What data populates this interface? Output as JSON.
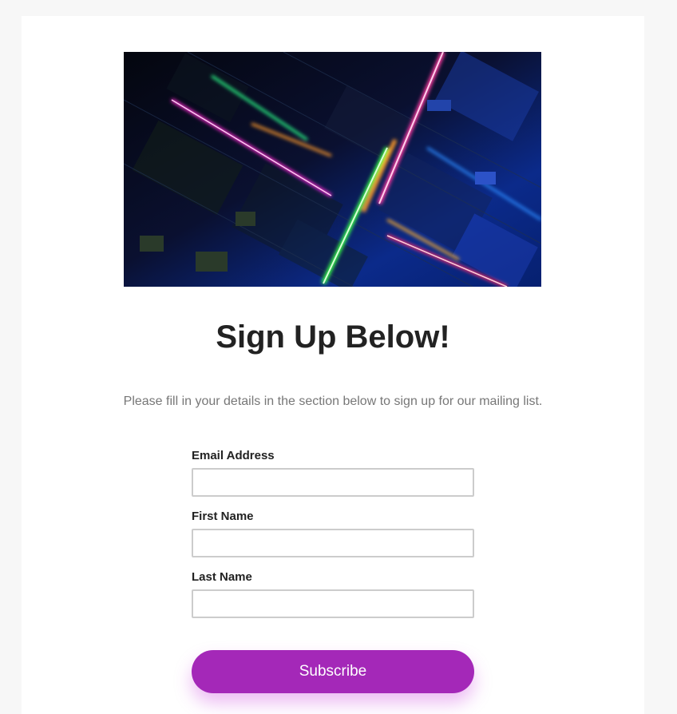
{
  "signup": {
    "hero_image": "abstract-circuit-board-neon-lights",
    "heading": "Sign Up Below!",
    "description": "Please fill in your details in the section below to sign up for our mailing list.",
    "fields": [
      {
        "label": "Email Address",
        "value": "",
        "placeholder": ""
      },
      {
        "label": "First Name",
        "value": "",
        "placeholder": ""
      },
      {
        "label": "Last Name",
        "value": "",
        "placeholder": ""
      }
    ],
    "submit_label": "Subscribe"
  },
  "colors": {
    "page_background": "#f7f7f7",
    "card_background": "#ffffff",
    "button": "#a428b8",
    "heading": "#222222",
    "description": "#777777",
    "input_border": "#cccccc"
  }
}
